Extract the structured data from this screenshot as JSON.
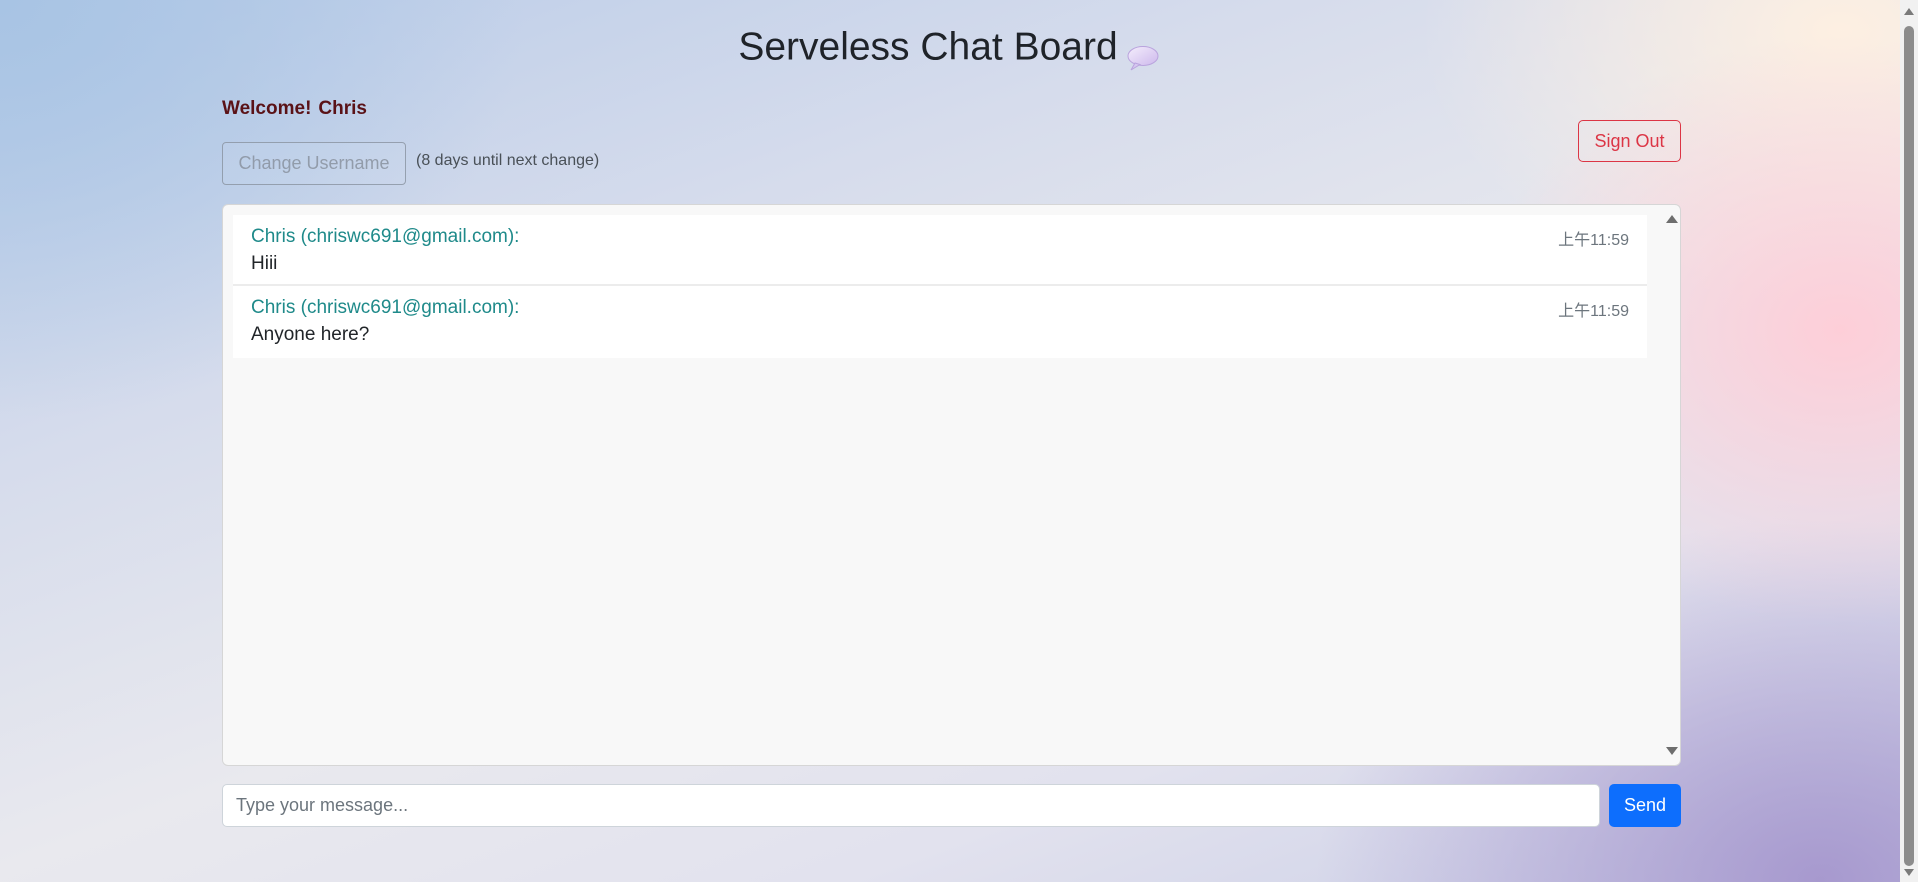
{
  "header": {
    "title": "Serveless Chat Board",
    "title_icon": "speech-bubble-icon"
  },
  "user": {
    "welcome_label": "Welcome!",
    "name": "Chris",
    "change_username_label": "Change Username",
    "change_username_hint": "(8 days until next change)",
    "sign_out_label": "Sign Out"
  },
  "messages": [
    {
      "author": "Chris (chriswc691@gmail.com):",
      "time": "上午11:59",
      "text": "Hiii"
    },
    {
      "author": "Chris (chriswc691@gmail.com):",
      "time": "上午11:59",
      "text": "Anyone here?"
    }
  ],
  "composer": {
    "value": "",
    "placeholder": "Type your message...",
    "send_label": "Send"
  },
  "colors": {
    "send_button": "#0d6efd",
    "sign_out": "#dc3545",
    "author": "#1f8a8a",
    "welcome": "#5a1217"
  }
}
